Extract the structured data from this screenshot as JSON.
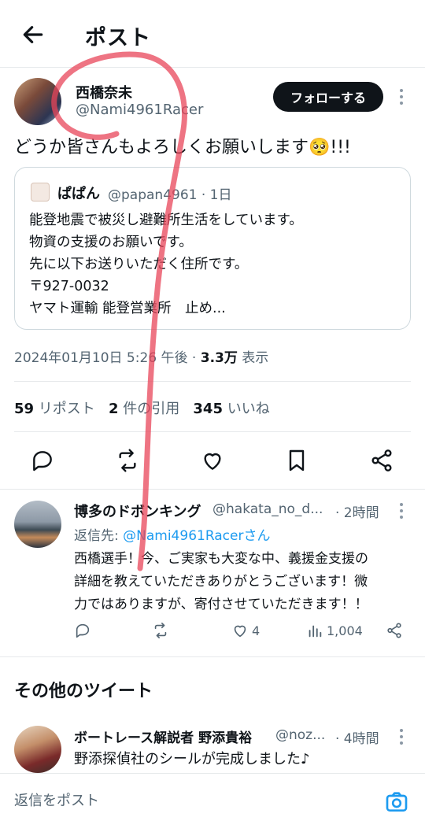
{
  "header": {
    "title": "ポスト"
  },
  "post": {
    "author_name": "西橋奈未",
    "author_handle": "@Nami4961Racer",
    "follow_label": "フォローする",
    "text": "どうか皆さんもよろしくお願いします🥺!!!",
    "quote": {
      "author_name": "ぱぱん",
      "author_handle": "@papan4961",
      "time": "· 1日",
      "lines": [
        "能登地震で被災し避難所生活をしています。",
        "物資の支援のお願いです。",
        "先に以下お送りいただく住所です。",
        "〒927-0032",
        "ヤマト運輸 能登営業所　止め..."
      ]
    },
    "timestamp": "2024年01月10日 5:26 午後",
    "views_count": "3.3万",
    "views_label": "表示",
    "reposts_count": "59",
    "reposts_label": "リポスト",
    "quotes_count": "2",
    "quotes_label": "件の引用",
    "likes_count": "345",
    "likes_label": "いいね"
  },
  "reply": {
    "author_name": "博多のドボンキング",
    "author_handle": "@hakata_no_d...",
    "time": "· 2時間",
    "reply_to_prefix": "返信先: ",
    "reply_to_handle": "@Nami4961Racerさん",
    "lines": [
      "西橋選手！今、ご実家も大変な中、義援金支援の",
      "詳細を教えていただきありがとうございます！微",
      "力ではありますが、寄付させていただきます！！"
    ],
    "likes": "4",
    "views": "1,004"
  },
  "more_tweets": {
    "title": "その他のツイート",
    "item": {
      "author_name": "ボートレース解説者 野添貴裕",
      "author_handle": "@noz...",
      "time": "· 4時間",
      "text": "野添探偵社のシールが完成しました♪"
    }
  },
  "composer": {
    "placeholder": "返信をポスト"
  },
  "colors": {
    "accent": "#1d9bf0",
    "text": "#0f1419",
    "muted": "#536471",
    "annotation_stroke": "#e8455a"
  }
}
